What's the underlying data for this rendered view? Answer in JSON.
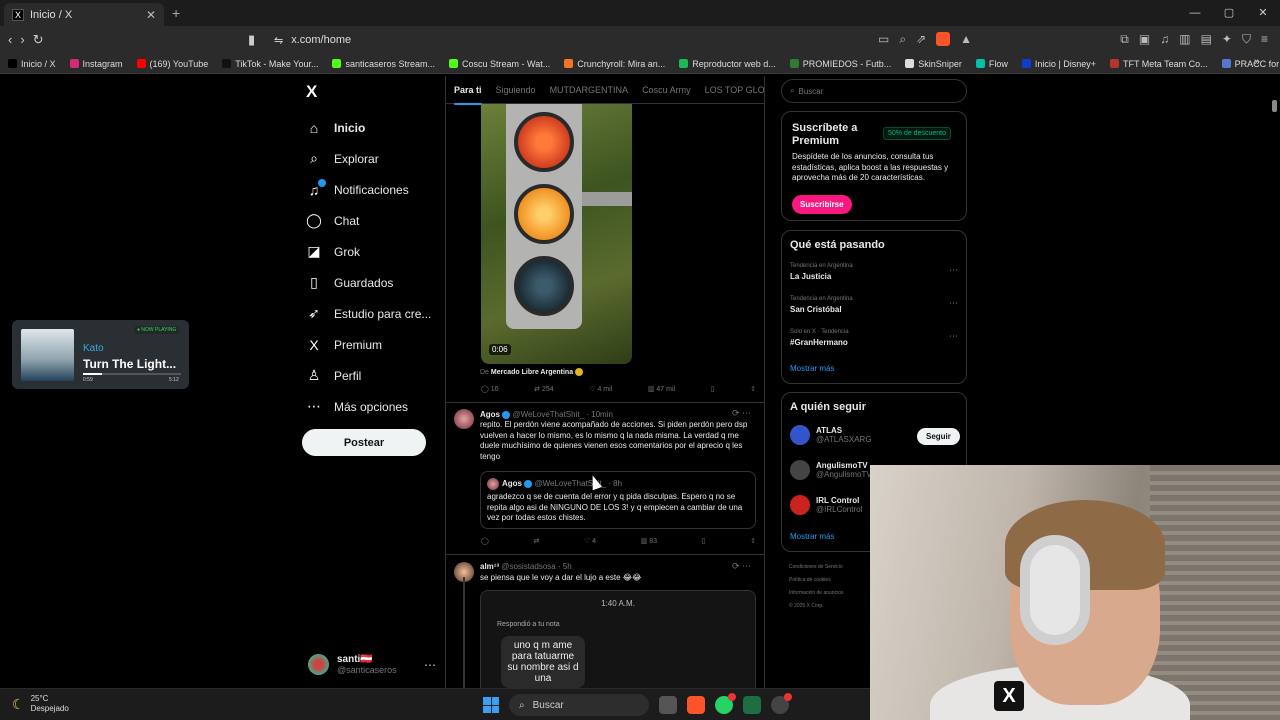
{
  "browser": {
    "tab_title": "Inicio / X",
    "url": "x.com/home",
    "new_tab": "+",
    "bookmarks": [
      {
        "label": "Inicio / X",
        "color": "#000000"
      },
      {
        "label": "Instagram",
        "color": "#d62976"
      },
      {
        "label": "(169) YouTube",
        "color": "#ff0000"
      },
      {
        "label": "TikTok - Make Your...",
        "color": "#111111"
      },
      {
        "label": "santicaseros Stream...",
        "color": "#53fc18"
      },
      {
        "label": "Coscu Stream - Wat...",
        "color": "#53fc18"
      },
      {
        "label": "Crunchyroll: Mira an...",
        "color": "#f47521"
      },
      {
        "label": "Reproductor web d...",
        "color": "#1db954"
      },
      {
        "label": "PROMIEDOS - Futb...",
        "color": "#2e7d32"
      },
      {
        "label": "SkinSniper",
        "color": "#dddddd"
      },
      {
        "label": "Flow",
        "color": "#00c2a8"
      },
      {
        "label": "Inicio | Disney+",
        "color": "#113ccf"
      },
      {
        "label": "TFT Meta Team Co...",
        "color": "#b5352a"
      },
      {
        "label": "PRACC for Counter-...",
        "color": "#5577cc"
      }
    ]
  },
  "sidebar": {
    "logo": "X",
    "items": [
      {
        "label": "Inicio",
        "icon": "home-icon",
        "glyph": "⌂"
      },
      {
        "label": "Explorar",
        "icon": "search-icon",
        "glyph": "⌕"
      },
      {
        "label": "Notificaciones",
        "icon": "bell-icon",
        "glyph": "♫"
      },
      {
        "label": "Chat",
        "icon": "chat-icon",
        "glyph": "◯"
      },
      {
        "label": "Grok",
        "icon": "grok-icon",
        "glyph": "◪"
      },
      {
        "label": "Guardados",
        "icon": "bookmark-icon",
        "glyph": "▯"
      },
      {
        "label": "Estudio para cre...",
        "icon": "rocket-icon",
        "glyph": "➶"
      },
      {
        "label": "Premium",
        "icon": "x-premium-icon",
        "glyph": "X"
      },
      {
        "label": "Perfil",
        "icon": "person-icon",
        "glyph": "♙"
      },
      {
        "label": "Más opciones",
        "icon": "more-circle-icon",
        "glyph": "⋯"
      }
    ],
    "post_button": "Postear",
    "account_name": "santi🇦🇹",
    "account_handle": "@santicaseros"
  },
  "feed": {
    "tabs": [
      "Para ti",
      "Siguiendo",
      "MUTDARGENTINA",
      "Coscu Army",
      "LOS TOP GLOBAL"
    ],
    "post1": {
      "video_duration": "0:06",
      "source_prefix": "De",
      "source_name": "Mercado Libre Argentina",
      "replies": "16",
      "reposts": "254",
      "likes": "4 mil",
      "views": "47 mil"
    },
    "post2": {
      "name": "Agos",
      "handle": "@WeLoveThatShit_ · 10min",
      "text": "repito. El perdón viene acompañado de acciones. Si piden perdón pero dsp vuelven a hacer lo mismo, es lo mismo q la nada misma. La verdad q me duele muchísimo de quienes vienen esos comentarios por el aprecio q les tengo",
      "quote_name": "Agos",
      "quote_handle": "@WeLoveThatShit_ · 8h",
      "quote_text": "agradezco q se de cuenta del error y q pida disculpas. Espero q no se repita algo asi de NINGUNO DE LOS 3! y q empiecen a cambiar de una vez por todas estos chistes.",
      "replies": "",
      "reposts": "",
      "likes": "4",
      "views": "83"
    },
    "post3": {
      "name": "alm¹³",
      "handle": "@sosistadsosa · 5h",
      "text": "se piensa que le voy a dar el lujo a este 😂😂",
      "shot_time": "1:40 A.M.",
      "shot_reply": "Respondió a tu nota",
      "bubble": "uno q m ame para tatuarme su nombre asi d una"
    }
  },
  "right": {
    "search_placeholder": "Buscar",
    "premium_title": "Suscríbete a Premium",
    "premium_badge": "50% de descuento",
    "premium_text": "Despídete de los anuncios, consulta tus estadísticas, aplica boost a las respuestas y aprovecha más de 20 características.",
    "premium_button": "Suscribirse",
    "trends_title": "Qué está pasando",
    "trends": [
      {
        "context": "Tendencia en Argentina",
        "name": "La Justicia"
      },
      {
        "context": "Tendencia en Argentina",
        "name": "San Cristóbal"
      },
      {
        "context": "Solo en X · Tendencia",
        "name": "#GranHermano"
      }
    ],
    "show_more": "Mostrar más",
    "follow_title": "A quién seguir",
    "follow": [
      {
        "name": "ATLAS",
        "handle": "@ATLASXARG",
        "color": "#3355cc"
      },
      {
        "name": "AngulismoTV",
        "handle": "@AngulismoTV",
        "color": "#444444"
      },
      {
        "name": "IRL Control",
        "handle": "@IRLControl",
        "color": "#cc2222"
      }
    ],
    "follow_button": "Seguir",
    "footer": [
      "Condiciones de Servicio",
      "Política de cookies",
      "Información de anuncios",
      "© 2025 X Corp."
    ]
  },
  "now_playing": {
    "tag": "● NOW PLAYING",
    "artist": "Kato",
    "song": "Turn The Light...",
    "elapsed": "0:59",
    "total": "5:12",
    "progress": 0.19
  },
  "taskbar": {
    "temp": "25°C",
    "weather": "Despejado",
    "search": "Buscar"
  }
}
